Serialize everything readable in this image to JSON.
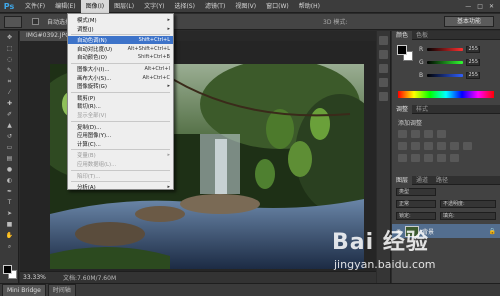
{
  "app": {
    "logo": "Ps"
  },
  "menubar": {
    "items": [
      "文件(F)",
      "编辑(E)",
      "图像(I)",
      "图层(L)",
      "文字(Y)",
      "选择(S)",
      "滤镜(T)",
      "视图(V)",
      "窗口(W)",
      "帮助(H)"
    ],
    "active_index": 2,
    "controls": [
      "—",
      "□",
      "✕"
    ]
  },
  "options_bar": {
    "auto_select_label": "自动选择:",
    "mode_3d_label": "3D 模式:",
    "workspace_label": "基本功能"
  },
  "document": {
    "tab_title": "IMG#0392.JPG ◎ ...",
    "zoom": "33.33%",
    "doc_info": "文档:7.60M/7.60M"
  },
  "image_menu": {
    "rows": [
      {
        "label": "模式(M)",
        "shortcut": "",
        "submenu": true,
        "disabled": false,
        "highlighted": false
      },
      {
        "label": "调整(J)",
        "shortcut": "",
        "submenu": true,
        "disabled": false,
        "highlighted": false
      },
      {
        "label": "自动色调(N)",
        "shortcut": "Shift+Ctrl+L",
        "submenu": false,
        "disabled": false,
        "highlighted": true
      },
      {
        "label": "自动对比度(U)",
        "shortcut": "Alt+Shift+Ctrl+L",
        "submenu": false,
        "disabled": false,
        "highlighted": false
      },
      {
        "label": "自动颜色(O)",
        "shortcut": "Shift+Ctrl+B",
        "submenu": false,
        "disabled": false,
        "highlighted": false
      },
      {
        "label": "图像大小(I)...",
        "shortcut": "Alt+Ctrl+I",
        "submenu": false,
        "disabled": false,
        "highlighted": false
      },
      {
        "label": "画布大小(S)...",
        "shortcut": "Alt+Ctrl+C",
        "submenu": false,
        "disabled": false,
        "highlighted": false
      },
      {
        "label": "图像旋转(G)",
        "shortcut": "",
        "submenu": true,
        "disabled": false,
        "highlighted": false
      },
      {
        "label": "裁剪(P)",
        "shortcut": "",
        "submenu": false,
        "disabled": false,
        "highlighted": false
      },
      {
        "label": "裁切(R)...",
        "shortcut": "",
        "submenu": false,
        "disabled": false,
        "highlighted": false
      },
      {
        "label": "显示全部(V)",
        "shortcut": "",
        "submenu": false,
        "disabled": true,
        "highlighted": false
      },
      {
        "label": "复制(D)...",
        "shortcut": "",
        "submenu": false,
        "disabled": false,
        "highlighted": false
      },
      {
        "label": "应用图像(Y)...",
        "shortcut": "",
        "submenu": false,
        "disabled": false,
        "highlighted": false
      },
      {
        "label": "计算(C)...",
        "shortcut": "",
        "submenu": false,
        "disabled": false,
        "highlighted": false
      },
      {
        "label": "变量(B)",
        "shortcut": "",
        "submenu": true,
        "disabled": true,
        "highlighted": false
      },
      {
        "label": "应用数据组(L)...",
        "shortcut": "",
        "submenu": false,
        "disabled": true,
        "highlighted": false
      },
      {
        "label": "陷印(T)...",
        "shortcut": "",
        "submenu": false,
        "disabled": true,
        "highlighted": false
      },
      {
        "label": "分析(A)",
        "shortcut": "",
        "submenu": true,
        "disabled": false,
        "highlighted": false
      }
    ],
    "separators_after": [
      1,
      4,
      7,
      10,
      13,
      15,
      16
    ]
  },
  "color_panel": {
    "tabs": [
      "颜色",
      "色板"
    ],
    "channels": [
      {
        "name": "R",
        "value": "255",
        "color": "#ff3030"
      },
      {
        "name": "G",
        "value": "255",
        "color": "#30ff30"
      },
      {
        "name": "B",
        "value": "255",
        "color": "#3060ff"
      }
    ]
  },
  "adjust_panel": {
    "tabs": [
      "调整",
      "样式"
    ],
    "title": "添加调整"
  },
  "layers_panel": {
    "tabs": [
      "图层",
      "通道",
      "路径"
    ],
    "kind_label": "类型",
    "blend_mode": "正常",
    "opacity_label": "不透明度:",
    "lock_label": "锁定:",
    "fill_label": "填充:",
    "layer_name": "背景"
  },
  "bottom_tabs": [
    "Mini Bridge",
    "时间轴"
  ],
  "watermark": {
    "logo_text": "Bai 经验",
    "url": "jingyan.baidu.com"
  }
}
